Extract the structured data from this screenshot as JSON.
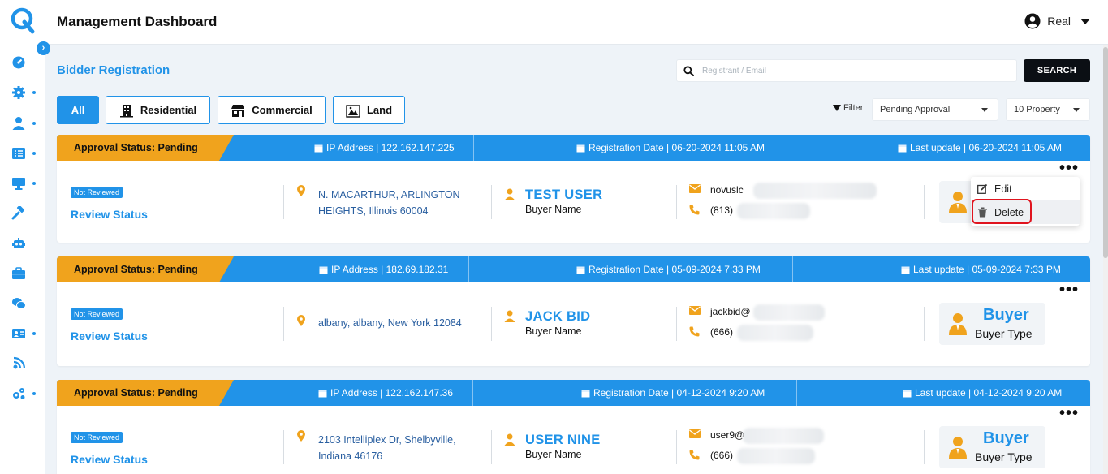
{
  "header": {
    "title": "Management Dashboard",
    "user_name": "Real"
  },
  "sidebar": {
    "icons": [
      "dashboard-icon",
      "settings-icon",
      "users-icon",
      "list-icon",
      "monitor-icon",
      "gavel-icon",
      "robot-icon",
      "briefcase-icon",
      "chat-icon",
      "id-card-icon",
      "broadcast-icon",
      "gears-icon"
    ]
  },
  "section": {
    "title": "Bidder Registration"
  },
  "search": {
    "placeholder": "Registrant / Email",
    "value": "",
    "button": "SEARCH"
  },
  "categories": [
    {
      "label": "All",
      "active": true
    },
    {
      "label": "Residential",
      "icon": "building-icon"
    },
    {
      "label": "Commercial",
      "icon": "store-icon"
    },
    {
      "label": "Land",
      "icon": "land-icon"
    }
  ],
  "filter": {
    "label": "Filter",
    "status": "Pending Approval",
    "count": "10 Property"
  },
  "cards": [
    {
      "approval": "Approval Status: Pending",
      "ip": "IP Address | 122.162.147.225",
      "registered": "Registration Date | 06-20-2024 11:05 AM",
      "updated": "Last update | 06-20-2024 11:05 AM",
      "badge": "Not Reviewed",
      "review": "Review Status",
      "address": "N. MACARTHUR, ARLINGTON HEIGHTS, Illinois 60004",
      "name": "TEST USER",
      "name_label": "Buyer Name",
      "email": "novuslc",
      "phone": "(813)",
      "type": "",
      "type_label": ""
    },
    {
      "approval": "Approval Status: Pending",
      "ip": "IP Address | 182.69.182.31",
      "registered": "Registration Date | 05-09-2024 7:33 PM",
      "updated": "Last update | 05-09-2024 7:33 PM",
      "badge": "Not Reviewed",
      "review": "Review Status",
      "address": "albany, albany, New York 12084",
      "name": "JACK BID",
      "name_label": "Buyer Name",
      "email": "jackbid@",
      "phone": "(666)",
      "type": "Buyer",
      "type_label": "Buyer Type"
    },
    {
      "approval": "Approval Status: Pending",
      "ip": "IP Address | 122.162.147.36",
      "registered": "Registration Date | 04-12-2024 9:20 AM",
      "updated": "Last update | 04-12-2024 9:20 AM",
      "badge": "Not Reviewed",
      "review": "Review Status",
      "address": "2103 Intelliplex Dr, Shelbyville, Indiana 46176",
      "name": "USER NINE",
      "name_label": "Buyer Name",
      "email": "user9@",
      "phone": "(666)",
      "type": "Buyer",
      "type_label": "Buyer Type"
    }
  ],
  "row_menu": {
    "edit": "Edit",
    "delete": "Delete"
  },
  "colors": {
    "primary": "#2193e8",
    "warning": "#f0a31d",
    "danger": "#e0141e",
    "dark": "#0b0f14"
  }
}
